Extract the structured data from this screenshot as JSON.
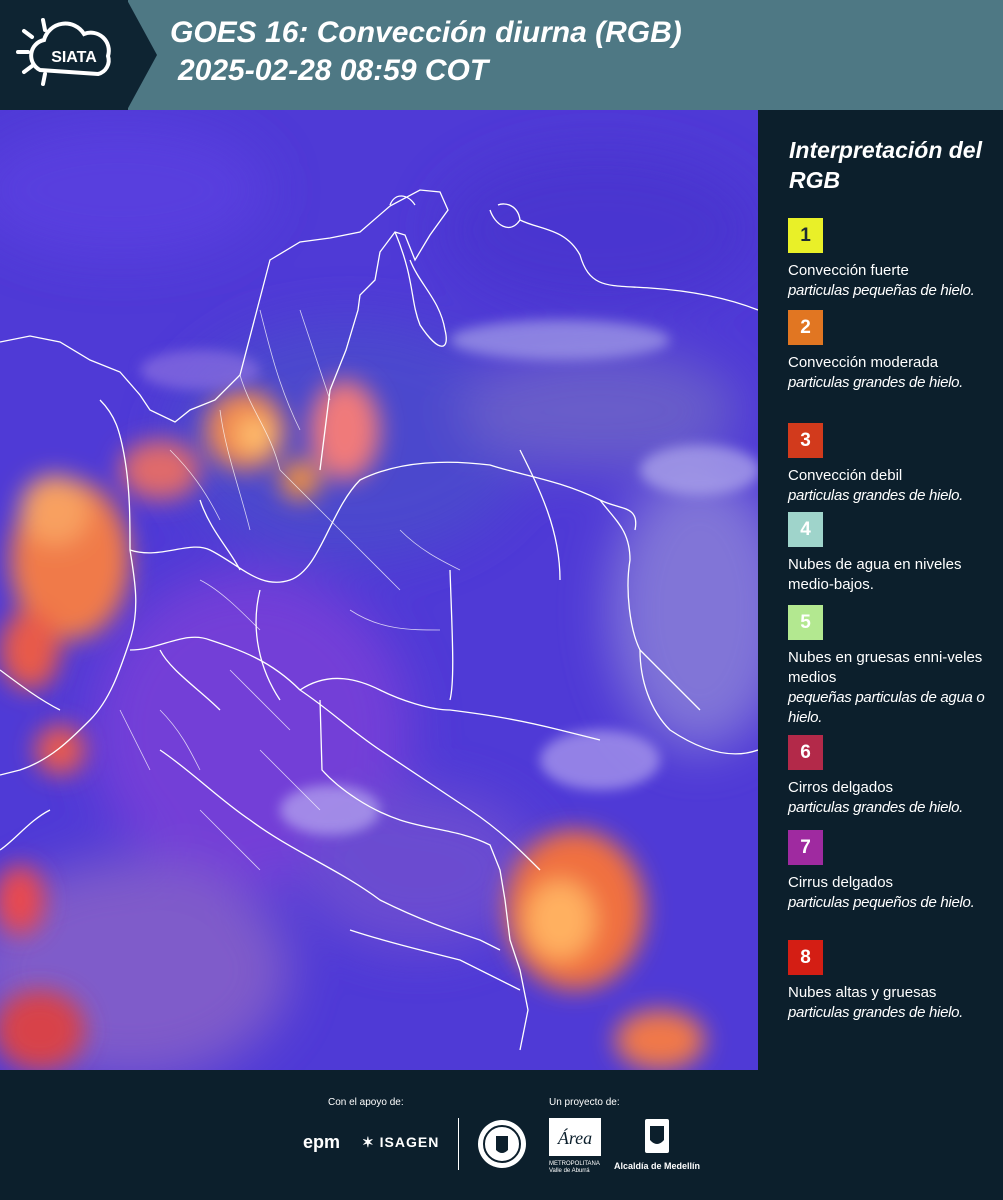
{
  "header": {
    "logo_text": "SIATA",
    "title_line1": "GOES 16: Convección diurna (RGB)",
    "title_line2": "2025-02-28 08:59 COT"
  },
  "legend": {
    "title": "Interpretación del RGB",
    "items": [
      {
        "number": "1",
        "color": "#e9f028",
        "title": "Convección fuerte",
        "subtitle": "particulas pequeñas de hielo."
      },
      {
        "number": "2",
        "color": "#e17622",
        "title": "Convección moderada",
        "subtitle": "particulas grandes de hielo."
      },
      {
        "number": "3",
        "color": "#d23a1c",
        "title": "Convección debil",
        "subtitle": "particulas grandes de hielo."
      },
      {
        "number": "4",
        "color": "#9fd4cb",
        "title": "Nubes de agua en niveles medio-bajos.",
        "subtitle": ""
      },
      {
        "number": "5",
        "color": "#b3e890",
        "title": "Nubes en gruesas enni-veles medios",
        "subtitle": "pequeñas particulas de agua o hielo."
      },
      {
        "number": "6",
        "color": "#b32949",
        "title": "Cirros delgados",
        "subtitle": "particulas grandes de hielo."
      },
      {
        "number": "7",
        "color": "#9f2aa0",
        "title": "Cirrus delgados",
        "subtitle": "particulas pequeños de hielo."
      },
      {
        "number": "8",
        "color": "#d41e14",
        "title": "Nubes altas y gruesas",
        "subtitle": "particulas grandes de hielo."
      }
    ]
  },
  "footer": {
    "support_label": "Con el apoyo de:",
    "project_label": "Un proyecto de:",
    "sponsors": [
      "epm",
      "ISAGEN"
    ],
    "partners": [
      "METROPOLITANA Valle de Aburrá",
      "Alcaldía de Medellín"
    ],
    "area_logo_text": "Área"
  }
}
